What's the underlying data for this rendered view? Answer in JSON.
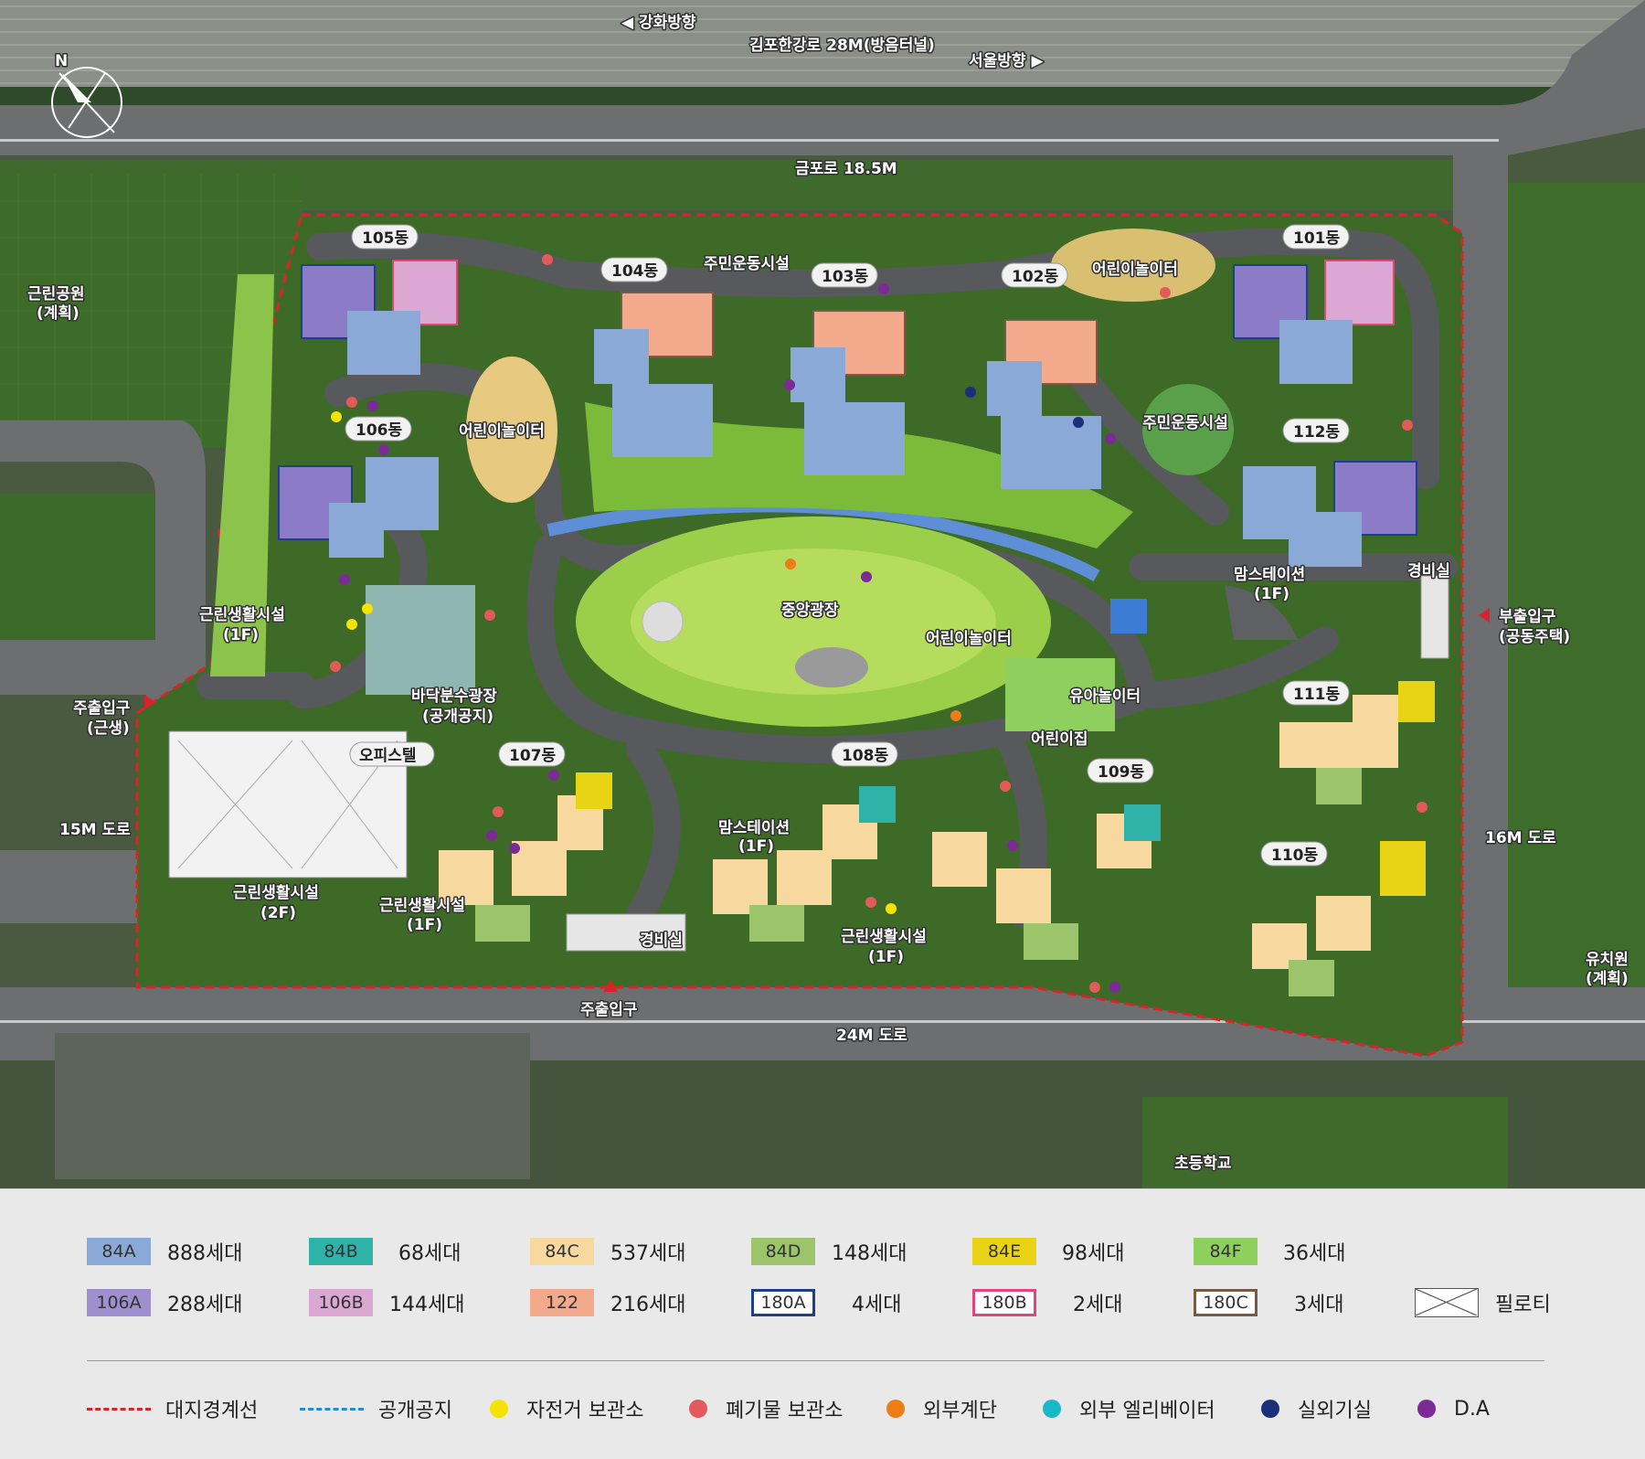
{
  "map": {
    "roads": {
      "gangwha": "◀  강화방향",
      "gimpo_hangang": "김포한강로 28M(방음터널)",
      "seoul": "서울방향  ▶",
      "geumpo": "금포로 18.5M",
      "road24": "24M 도로",
      "road15": "15M 도로",
      "road16": "16M 도로"
    },
    "surroundings": {
      "park_line1": "근린공원",
      "park_line2": "(계획)",
      "kinder_line1": "유치원",
      "kinder_line2": "(계획)",
      "school": "초등학교"
    },
    "entrances": {
      "main_left_line1": "주출입구",
      "main_left_line2": "(근생)",
      "main_bottom": "주출입구",
      "sub_right_line1": "부출입구",
      "sub_right_line2": "(공동주택)"
    },
    "buildings": {
      "b101": "101동",
      "b102": "102동",
      "b103": "103동",
      "b104": "104동",
      "b105": "105동",
      "b106": "106동",
      "b107": "107동",
      "b108": "108동",
      "b109": "109동",
      "b110": "110동",
      "b111": "111동",
      "b112": "112동",
      "officetel": "오피스텔"
    },
    "facilities": {
      "fitness_top": "주민운동시설",
      "fitness_right": "주민운동시설",
      "playground_top": "어린이놀이터",
      "playground_left": "어린이놀이터",
      "playground_center": "어린이놀이터",
      "central_plaza": "중앙광장",
      "toddler_play": "유아놀이터",
      "daycare": "어린이집",
      "fountain_line1": "바닥분수광장",
      "fountain_line2": "(공개공지)",
      "momstation_right_line1": "맘스테이션",
      "momstation_right_line2": "(1F)",
      "momstation_center_line1": "맘스테이션",
      "momstation_center_line2": "(1F)",
      "guard_right": "경비실",
      "guard_bottom": "경비실",
      "retail_left_line1": "근린생활시설",
      "retail_left_line2": "(1F)",
      "retail_2f_line1": "근린생활시설",
      "retail_2f_line2": "(2F)",
      "retail_1f_line1": "근린생활시설",
      "retail_1f_line2": "(1F)",
      "retail_bottom_line1": "근린생활시설",
      "retail_bottom_line2": "(1F)"
    },
    "compass": "N"
  },
  "legend": {
    "units": [
      {
        "type": "84A",
        "count": "888세대",
        "color": "#8aa9d6",
        "style": "fill"
      },
      {
        "type": "84B",
        "count": "68세대",
        "color": "#2fb3a8",
        "style": "fill"
      },
      {
        "type": "84C",
        "count": "537세대",
        "color": "#f7d9a0",
        "style": "fill"
      },
      {
        "type": "84D",
        "count": "148세대",
        "color": "#9cc46a",
        "style": "fill"
      },
      {
        "type": "84E",
        "count": "98세대",
        "color": "#e8d415",
        "style": "fill"
      },
      {
        "type": "84F",
        "count": "36세대",
        "color": "#8fcf5e",
        "style": "fill"
      },
      {
        "type": "106A",
        "count": "288세대",
        "color": "#9f8fcf",
        "style": "fill"
      },
      {
        "type": "106B",
        "count": "144세대",
        "color": "#dba8d3",
        "style": "fill"
      },
      {
        "type": "122",
        "count": "216세대",
        "color": "#f2a98c",
        "style": "fill"
      },
      {
        "type": "180A",
        "count": "4세대",
        "color": "#1d3f8c",
        "style": "outline"
      },
      {
        "type": "180B",
        "count": "2세대",
        "color": "#e2457a",
        "style": "outline"
      },
      {
        "type": "180C",
        "count": "3세대",
        "color": "#7a5a45",
        "style": "outline"
      }
    ],
    "piloti": "필로티",
    "symbols": [
      {
        "label": "대지경계선",
        "kind": "dash",
        "color": "#d9232a"
      },
      {
        "label": "공개공지",
        "kind": "dash",
        "color": "#1e8fd6"
      },
      {
        "label": "자전거 보관소",
        "kind": "dot",
        "color": "#f4e200"
      },
      {
        "label": "폐기물 보관소",
        "kind": "dot",
        "color": "#e25a5a"
      },
      {
        "label": "외부계단",
        "kind": "dot",
        "color": "#ec7d17"
      },
      {
        "label": "외부 엘리베이터",
        "kind": "dot",
        "color": "#19b8c8"
      },
      {
        "label": "실외기실",
        "kind": "dot",
        "color": "#1b2f7a"
      },
      {
        "label": "D.A",
        "kind": "dot",
        "color": "#7b2a96"
      }
    ]
  }
}
